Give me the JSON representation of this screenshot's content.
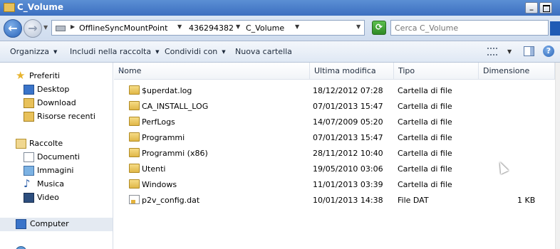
{
  "window": {
    "title": "C_Volume"
  },
  "address": {
    "crumbs": [
      "OfflineSyncMountPoint",
      "436294382",
      "C_Volume"
    ]
  },
  "search": {
    "placeholder": "Cerca C_Volume"
  },
  "commands": {
    "organize": "Organizza",
    "include": "Includi nella raccolta",
    "share": "Condividi con",
    "new_folder": "Nuova cartella"
  },
  "sidebar": {
    "favorites": {
      "label": "Preferiti",
      "items": [
        "Desktop",
        "Download",
        "Risorse recenti"
      ]
    },
    "libraries": {
      "label": "Raccolte",
      "items": [
        "Documenti",
        "Immagini",
        "Musica",
        "Video"
      ]
    },
    "computer": "Computer"
  },
  "columns": {
    "name": "Nome",
    "modified": "Ultima modifica",
    "type": "Tipo",
    "size": "Dimensione"
  },
  "files": [
    {
      "name": "$uperdat.log",
      "modified": "18/12/2012 07:28",
      "type": "Cartella di file",
      "size": "",
      "icon": "folder"
    },
    {
      "name": "CA_INSTALL_LOG",
      "modified": "07/01/2013 15:47",
      "type": "Cartella di file",
      "size": "",
      "icon": "folder"
    },
    {
      "name": "PerfLogs",
      "modified": "14/07/2009 05:20",
      "type": "Cartella di file",
      "size": "",
      "icon": "folder"
    },
    {
      "name": "Programmi",
      "modified": "07/01/2013 15:47",
      "type": "Cartella di file",
      "size": "",
      "icon": "folder"
    },
    {
      "name": "Programmi (x86)",
      "modified": "28/11/2012 10:40",
      "type": "Cartella di file",
      "size": "",
      "icon": "folder"
    },
    {
      "name": "Utenti",
      "modified": "19/05/2010 03:06",
      "type": "Cartella di file",
      "size": "",
      "icon": "folder"
    },
    {
      "name": "Windows",
      "modified": "11/01/2013 03:39",
      "type": "Cartella di file",
      "size": "",
      "icon": "folder"
    },
    {
      "name": "p2v_config.dat",
      "modified": "10/01/2013 14:38",
      "type": "File DAT",
      "size": "1 KB",
      "icon": "file"
    }
  ]
}
